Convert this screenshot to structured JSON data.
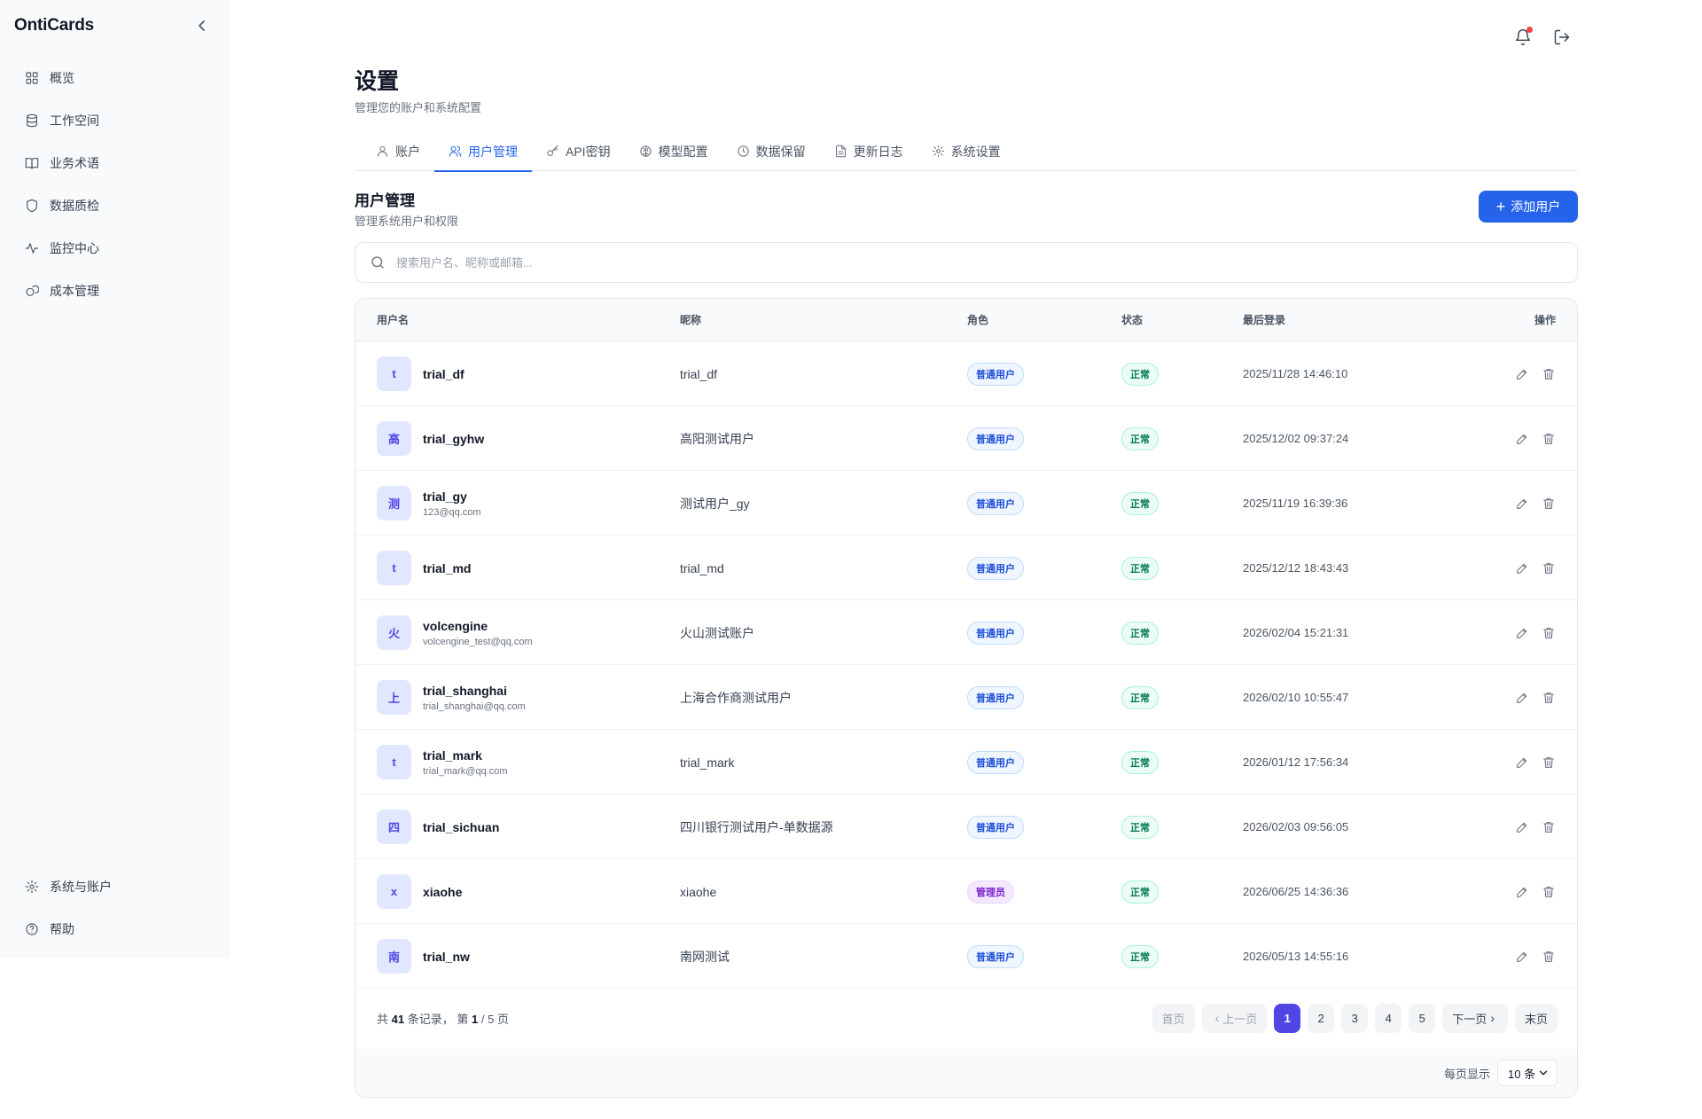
{
  "app": {
    "brand": "OntiCards"
  },
  "sidebar": {
    "items": [
      {
        "label": "概览",
        "icon": "grid-icon"
      },
      {
        "label": "工作空间",
        "icon": "database-icon"
      },
      {
        "label": "业务术语",
        "icon": "book-icon"
      },
      {
        "label": "数据质检",
        "icon": "shield-icon"
      },
      {
        "label": "监控中心",
        "icon": "activity-icon"
      },
      {
        "label": "成本管理",
        "icon": "coins-icon"
      }
    ],
    "bottom": [
      {
        "label": "系统与账户",
        "icon": "gear-icon"
      },
      {
        "label": "帮助",
        "icon": "help-icon"
      }
    ]
  },
  "header": {
    "title": "设置",
    "subtitle": "管理您的账户和系统配置"
  },
  "tabs": [
    {
      "label": "账户",
      "icon": "user-icon"
    },
    {
      "label": "用户管理",
      "icon": "users-icon",
      "active": true
    },
    {
      "label": "API密钥",
      "icon": "key-icon"
    },
    {
      "label": "模型配置",
      "icon": "brain-icon"
    },
    {
      "label": "数据保留",
      "icon": "clock-icon"
    },
    {
      "label": "更新日志",
      "icon": "file-icon"
    },
    {
      "label": "系统设置",
      "icon": "gear-icon"
    }
  ],
  "section": {
    "title": "用户管理",
    "subtitle": "管理系统用户和权限",
    "add_label": "添加用户"
  },
  "search": {
    "placeholder": "搜索用户名、昵称或邮箱...",
    "value": ""
  },
  "table": {
    "columns": [
      "用户名",
      "昵称",
      "角色",
      "状态",
      "最后登录",
      "操作"
    ],
    "rows": [
      {
        "avatar": "t",
        "username": "trial_df",
        "email": "",
        "nickname": "trial_df",
        "role": "普通用户",
        "status": "正常",
        "last_login": "2025/11/28 14:46:10"
      },
      {
        "avatar": "高",
        "username": "trial_gyhw",
        "email": "",
        "nickname": "高阳测试用户",
        "role": "普通用户",
        "status": "正常",
        "last_login": "2025/12/02 09:37:24"
      },
      {
        "avatar": "测",
        "username": "trial_gy",
        "email": "123@qq.com",
        "nickname": "测试用户_gy",
        "role": "普通用户",
        "status": "正常",
        "last_login": "2025/11/19 16:39:36"
      },
      {
        "avatar": "t",
        "username": "trial_md",
        "email": "",
        "nickname": "trial_md",
        "role": "普通用户",
        "status": "正常",
        "last_login": "2025/12/12 18:43:43"
      },
      {
        "avatar": "火",
        "username": "volcengine",
        "email": "volcengine_test@qq.com",
        "nickname": "火山测试账户",
        "role": "普通用户",
        "status": "正常",
        "last_login": "2026/02/04 15:21:31"
      },
      {
        "avatar": "上",
        "username": "trial_shanghai",
        "email": "trial_shanghai@qq.com",
        "nickname": "上海合作商测试用户",
        "role": "普通用户",
        "status": "正常",
        "last_login": "2026/02/10 10:55:47"
      },
      {
        "avatar": "t",
        "username": "trial_mark",
        "email": "trial_mark@qq.com",
        "nickname": "trial_mark",
        "role": "普通用户",
        "status": "正常",
        "last_login": "2026/01/12 17:56:34"
      },
      {
        "avatar": "四",
        "username": "trial_sichuan",
        "email": "",
        "nickname": "四川银行测试用户-单数据源",
        "role": "普通用户",
        "status": "正常",
        "last_login": "2026/02/03 09:56:05"
      },
      {
        "avatar": "x",
        "username": "xiaohe",
        "email": "",
        "nickname": "xiaohe",
        "role": "管理员",
        "status": "正常",
        "last_login": "2026/06/25 14:36:36"
      },
      {
        "avatar": "南",
        "username": "trial_nw",
        "email": "",
        "nickname": "南网测试",
        "role": "普通用户",
        "status": "正常",
        "last_login": "2026/05/13 14:55:16"
      }
    ]
  },
  "pagination": {
    "total_prefix": "共",
    "total": "41",
    "total_suffix": "条记录，",
    "page_prefix": "第",
    "current": "1",
    "page_sep": "/ 5 页",
    "first": "首页",
    "prev": "上一页",
    "pages": [
      "1",
      "2",
      "3",
      "4",
      "5"
    ],
    "next": "下一页",
    "last": "末页",
    "per_page_label": "每页显示",
    "per_page_value": "10 条"
  },
  "colors": {
    "accent": "#2563eb",
    "active_page": "#4f46e5",
    "notify_dot": "#ef4444"
  }
}
